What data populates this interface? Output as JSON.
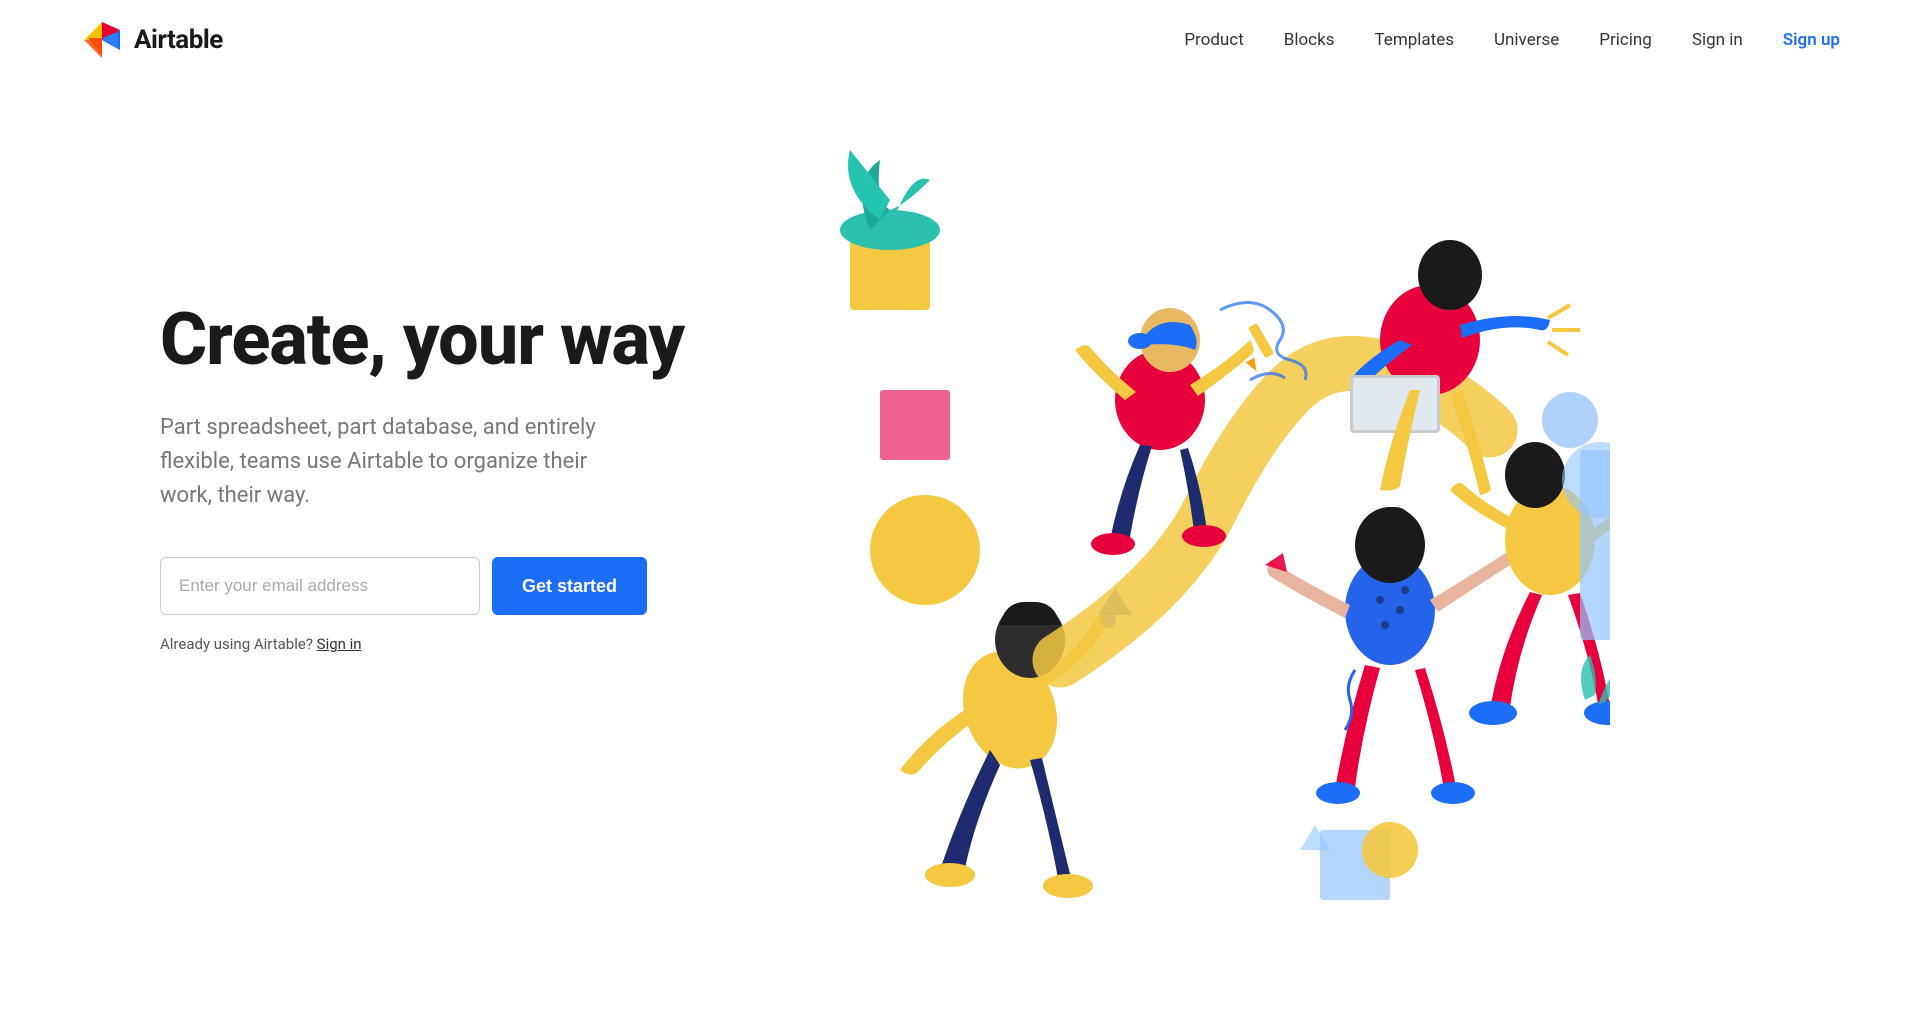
{
  "logo": {
    "text": "Airtable",
    "alt": "Airtable logo"
  },
  "nav": {
    "items": [
      {
        "label": "Product",
        "id": "product"
      },
      {
        "label": "Blocks",
        "id": "blocks"
      },
      {
        "label": "Templates",
        "id": "templates"
      },
      {
        "label": "Universe",
        "id": "universe"
      },
      {
        "label": "Pricing",
        "id": "pricing"
      }
    ],
    "signin_label": "Sign in",
    "signup_label": "Sign up"
  },
  "hero": {
    "heading": "Create, your way",
    "subtext": "Part spreadsheet, part database, and entirely flexible, teams use Airtable to organize their work, their way.",
    "email_placeholder": "Enter your email address",
    "cta_label": "Get started",
    "signin_note": "Already using Airtable?",
    "signin_link": "Sign in"
  }
}
